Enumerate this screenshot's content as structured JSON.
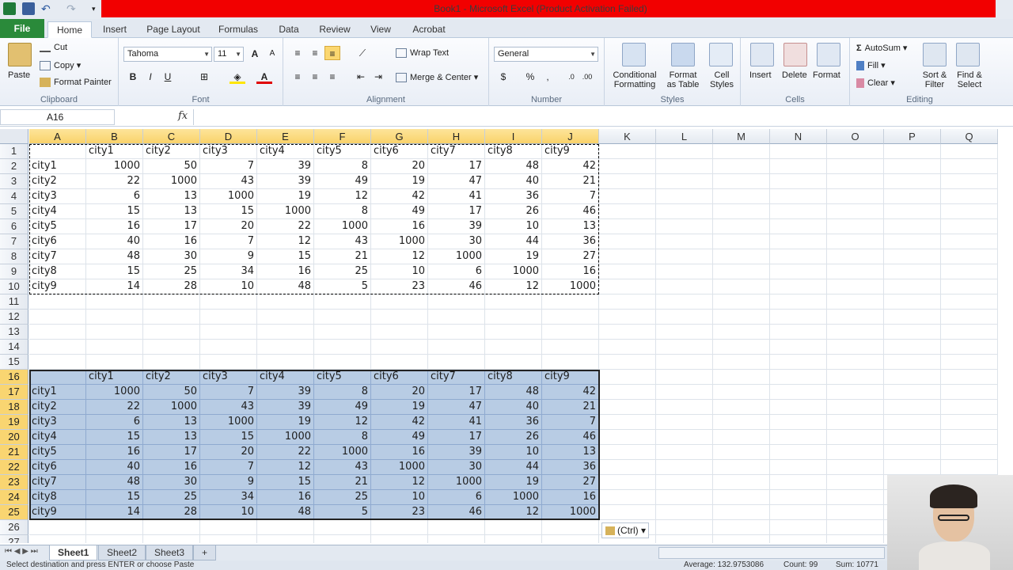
{
  "titlebar": {
    "title": "Book1  -  Microsoft Excel (Product Activation Failed)"
  },
  "tabs": [
    "File",
    "Home",
    "Insert",
    "Page Layout",
    "Formulas",
    "Data",
    "Review",
    "View",
    "Acrobat"
  ],
  "ribbon": {
    "clipboard": {
      "paste": "Paste",
      "cut": "Cut",
      "copy": "Copy",
      "format_painter": "Format Painter",
      "label": "Clipboard"
    },
    "font": {
      "name": "Tahoma",
      "size": "11",
      "label": "Font"
    },
    "alignment": {
      "wrap_text": "Wrap Text",
      "merge_center": "Merge & Center",
      "label": "Alignment"
    },
    "number": {
      "format": "General",
      "label": "Number"
    },
    "styles": {
      "conditional": "Conditional",
      "conditional2": "Formatting",
      "format_as": "Format",
      "format_as2": "as Table",
      "cell": "Cell",
      "cell2": "Styles",
      "label": "Styles"
    },
    "cells": {
      "insert": "Insert",
      "delete": "Delete",
      "format": "Format",
      "label": "Cells"
    },
    "editing": {
      "autosum": "AutoSum",
      "fill": "Fill",
      "clear": "Clear",
      "sort": "Sort &",
      "sort2": "Filter",
      "find": "Find &",
      "find2": "Select",
      "label": "Editing"
    }
  },
  "formula_bar": {
    "name_box": "A16",
    "fx": "fx",
    "formula": ""
  },
  "columns": [
    "A",
    "B",
    "C",
    "D",
    "E",
    "F",
    "G",
    "H",
    "I",
    "J",
    "K",
    "L",
    "M",
    "N",
    "O",
    "P",
    "Q"
  ],
  "table1": {
    "header": [
      "",
      "city1",
      "city2",
      "city3",
      "city4",
      "city5",
      "city6",
      "city7",
      "city8",
      "city9"
    ],
    "rows": [
      [
        "city1",
        "1000",
        "50",
        "7",
        "39",
        "8",
        "20",
        "17",
        "48",
        "42"
      ],
      [
        "city2",
        "22",
        "1000",
        "43",
        "39",
        "49",
        "19",
        "47",
        "40",
        "21"
      ],
      [
        "city3",
        "6",
        "13",
        "1000",
        "19",
        "12",
        "42",
        "41",
        "36",
        "7"
      ],
      [
        "city4",
        "15",
        "13",
        "15",
        "1000",
        "8",
        "49",
        "17",
        "26",
        "46"
      ],
      [
        "city5",
        "16",
        "17",
        "20",
        "22",
        "1000",
        "16",
        "39",
        "10",
        "13"
      ],
      [
        "city6",
        "40",
        "16",
        "7",
        "12",
        "43",
        "1000",
        "30",
        "44",
        "36"
      ],
      [
        "city7",
        "48",
        "30",
        "9",
        "15",
        "21",
        "12",
        "1000",
        "19",
        "27"
      ],
      [
        "city8",
        "15",
        "25",
        "34",
        "16",
        "25",
        "10",
        "6",
        "1000",
        "16"
      ],
      [
        "city9",
        "14",
        "28",
        "10",
        "48",
        "5",
        "23",
        "46",
        "12",
        "1000"
      ]
    ]
  },
  "table2": {
    "header": [
      "",
      "city1",
      "city2",
      "city3",
      "city4",
      "city5",
      "city6",
      "city7",
      "city8",
      "city9"
    ],
    "rows": [
      [
        "city1",
        "1000",
        "50",
        "7",
        "39",
        "8",
        "20",
        "17",
        "48",
        "42"
      ],
      [
        "city2",
        "22",
        "1000",
        "43",
        "39",
        "49",
        "19",
        "47",
        "40",
        "21"
      ],
      [
        "city3",
        "6",
        "13",
        "1000",
        "19",
        "12",
        "42",
        "41",
        "36",
        "7"
      ],
      [
        "city4",
        "15",
        "13",
        "15",
        "1000",
        "8",
        "49",
        "17",
        "26",
        "46"
      ],
      [
        "city5",
        "16",
        "17",
        "20",
        "22",
        "1000",
        "16",
        "39",
        "10",
        "13"
      ],
      [
        "city6",
        "40",
        "16",
        "7",
        "12",
        "43",
        "1000",
        "30",
        "44",
        "36"
      ],
      [
        "city7",
        "48",
        "30",
        "9",
        "15",
        "21",
        "12",
        "1000",
        "19",
        "27"
      ],
      [
        "city8",
        "15",
        "25",
        "34",
        "16",
        "25",
        "10",
        "6",
        "1000",
        "16"
      ],
      [
        "city9",
        "14",
        "28",
        "10",
        "48",
        "5",
        "23",
        "46",
        "12",
        "1000"
      ]
    ]
  },
  "paste_options": "(Ctrl)",
  "sheets": [
    "Sheet1",
    "Sheet2",
    "Sheet3"
  ],
  "status": {
    "message": "Select destination and press ENTER or choose Paste",
    "average": "Average: 132.9753086",
    "count": "Count: 99",
    "sum": "Sum: 10771"
  }
}
